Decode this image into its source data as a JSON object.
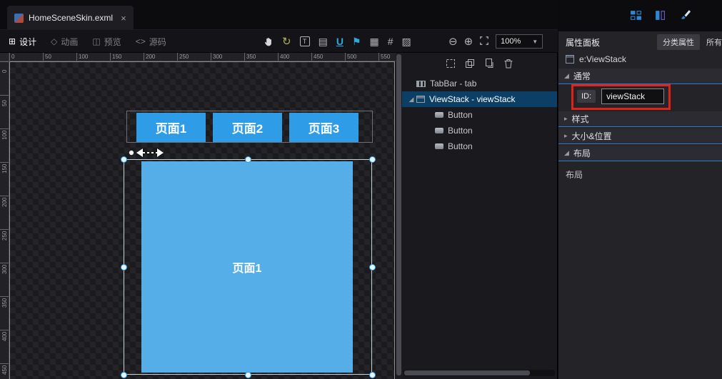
{
  "window": {
    "tab_title": "HomeSceneSkin.exml",
    "close_label": "×"
  },
  "toolbar": {
    "modes": [
      {
        "label": "设计",
        "icon_glyph": "⊞"
      },
      {
        "label": "动画",
        "icon_glyph": "◇"
      },
      {
        "label": "预览",
        "icon_glyph": "◫"
      },
      {
        "label": "源码",
        "icon_glyph": "<>"
      }
    ],
    "tool_icons": [
      {
        "name": "refresh",
        "glyph": "↻"
      },
      {
        "name": "transform-tool",
        "glyph": "T"
      },
      {
        "name": "layers-brush",
        "glyph": "▤"
      },
      {
        "name": "u-tool",
        "glyph": "U"
      },
      {
        "name": "flag-tool",
        "glyph": "⚑"
      },
      {
        "name": "grid-tool",
        "glyph": "▦"
      },
      {
        "name": "snap-grid",
        "glyph": "#"
      },
      {
        "name": "grid-edit",
        "glyph": "▨"
      }
    ],
    "zoom_out_glyph": "⊖",
    "zoom_in_glyph": "⊕",
    "zoom_value": "100%",
    "dropdown_arrow_glyph": "▼"
  },
  "canvas": {
    "ruler_top": [
      "0",
      "50",
      "100",
      "150",
      "200",
      "250",
      "300",
      "350",
      "400",
      "450",
      "500",
      "550"
    ],
    "ruler_left": [
      "0",
      "50",
      "100",
      "150",
      "200",
      "250",
      "300",
      "350",
      "400",
      "450"
    ],
    "tab_buttons": [
      "页面1",
      "页面2",
      "页面3"
    ],
    "page_label": "页面1"
  },
  "outline": {
    "items": [
      {
        "label": "TabBar - tab",
        "icon": "tabbar",
        "depth": 0,
        "arrow": "",
        "selected": false
      },
      {
        "label": "ViewStack - viewStack",
        "icon": "viewstack",
        "depth": 0,
        "arrow": "◢",
        "selected": true
      },
      {
        "label": "Button",
        "icon": "button",
        "depth": 1,
        "arrow": "",
        "selected": false
      },
      {
        "label": "Button",
        "icon": "button",
        "depth": 1,
        "arrow": "",
        "selected": false
      },
      {
        "label": "Button",
        "icon": "button",
        "depth": 1,
        "arrow": "",
        "selected": false
      }
    ]
  },
  "properties": {
    "panel_title": "属性面板",
    "tabs": [
      "分类属性",
      "所有"
    ],
    "component_name": "e:ViewStack",
    "sections": [
      {
        "label": "通常",
        "arrow": "◢"
      },
      {
        "label": "样式",
        "arrow": "▸"
      },
      {
        "label": "大小&位置",
        "arrow": "▸"
      },
      {
        "label": "布局",
        "arrow": "◢"
      }
    ],
    "id_label": "ID:",
    "id_value": "viewStack",
    "layout_field_label": "布局"
  },
  "colors": {
    "accent_blue": "#2e9fe8",
    "page_blue": "#56aee8",
    "button_blue": "#2f9ce8",
    "annotation_red": "#e02318",
    "selection_row": "#0b3f66"
  }
}
